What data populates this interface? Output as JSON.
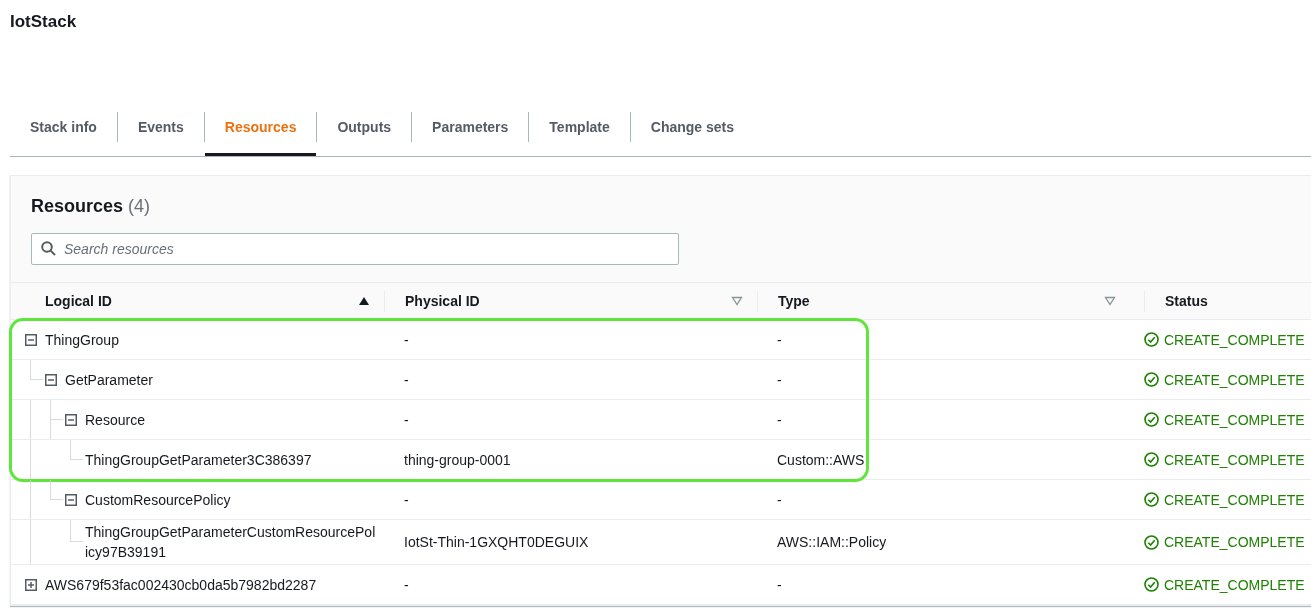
{
  "page_title": "IotStack",
  "tabs": [
    {
      "label": "Stack info",
      "selected": false
    },
    {
      "label": "Events",
      "selected": false
    },
    {
      "label": "Resources",
      "selected": true
    },
    {
      "label": "Outputs",
      "selected": false
    },
    {
      "label": "Parameters",
      "selected": false
    },
    {
      "label": "Template",
      "selected": false
    },
    {
      "label": "Change sets",
      "selected": false
    }
  ],
  "panel": {
    "title": "Resources",
    "count": "(4)"
  },
  "search": {
    "placeholder": "Search resources"
  },
  "table": {
    "columns": [
      {
        "label": "Logical ID",
        "sorted": true
      },
      {
        "label": "Physical ID",
        "sorted": false
      },
      {
        "label": "Type",
        "sorted": false
      },
      {
        "label": "Status"
      }
    ],
    "rows": [
      {
        "logical_id": "ThingGroup",
        "physical_id": "-",
        "type": "-",
        "status": "CREATE_COMPLETE",
        "expanded": true,
        "highlighted": true,
        "children": [
          {
            "logical_id": "GetParameter",
            "physical_id": "-",
            "type": "-",
            "status": "CREATE_COMPLETE",
            "expanded": true,
            "highlighted": true,
            "children": [
              {
                "logical_id": "Resource",
                "physical_id": "-",
                "type": "-",
                "status": "CREATE_COMPLETE",
                "expanded": true,
                "highlighted": true,
                "children": [
                  {
                    "logical_id": "ThingGroupGetParameter3C386397",
                    "physical_id": "thing-group-0001",
                    "type": "Custom::AWS",
                    "status": "CREATE_COMPLETE",
                    "highlighted": true
                  }
                ]
              },
              {
                "logical_id": "CustomResourcePolicy",
                "physical_id": "-",
                "type": "-",
                "status": "CREATE_COMPLETE",
                "expanded": true,
                "highlighted": false,
                "children": [
                  {
                    "logical_id": "ThingGroupGetParameterCustomResourcePolicy97B39191",
                    "physical_id": "IotSt-Thin-1GXQHT0DEGUIX",
                    "type": "AWS::IAM::Policy",
                    "status": "CREATE_COMPLETE",
                    "highlighted": false
                  }
                ]
              }
            ]
          }
        ]
      },
      {
        "logical_id": "AWS679f53fac002430cb0da5b7982bd2287",
        "physical_id": "-",
        "type": "-",
        "status": "CREATE_COMPLETE",
        "expanded": false,
        "highlighted": false,
        "children": []
      }
    ]
  }
}
